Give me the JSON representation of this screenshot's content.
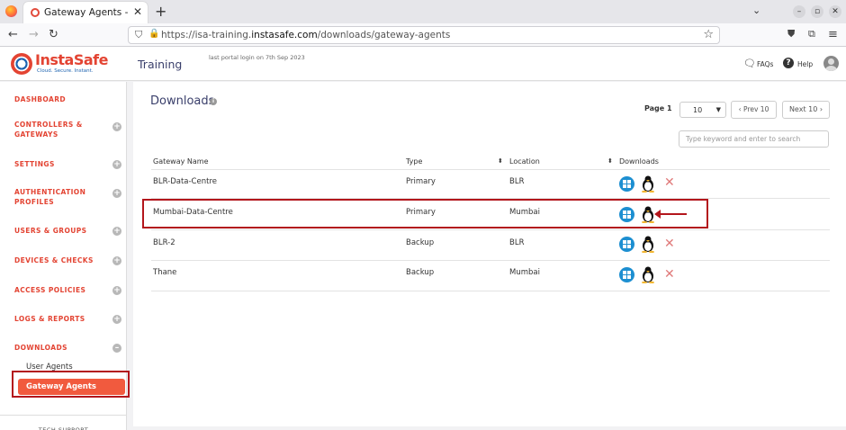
{
  "browser": {
    "tab_title": "Gateway Agents - Trainin",
    "url_prefix": "https://isa-training.",
    "url_domain": "instasafe.com",
    "url_path": "/downloads/gateway-agents"
  },
  "header": {
    "logo_text": "InstaSafe",
    "logo_tagline": "Cloud. Secure. Instant.",
    "title": "Training",
    "last_login": "last portal login on 7th Sep 2023",
    "faqs": "FAQs",
    "help": "Help"
  },
  "sidebar": {
    "items": [
      {
        "label": "DASHBOARD"
      },
      {
        "label": "CONTROLLERS &",
        "label2": "GATEWAYS"
      },
      {
        "label": "SETTINGS"
      },
      {
        "label": "AUTHENTICATION",
        "label2": "PROFILES"
      },
      {
        "label": "USERS & GROUPS"
      },
      {
        "label": "DEVICES & CHECKS"
      },
      {
        "label": "ACCESS POLICIES"
      },
      {
        "label": "LOGS & REPORTS"
      },
      {
        "label": "DOWNLOADS"
      }
    ],
    "sub_items": [
      "User Agents",
      "Gateway Agents"
    ],
    "footer": "TECH SUPPORT"
  },
  "main": {
    "title": "Downloads",
    "page_label": "Page 1",
    "page_size": "10",
    "prev_label": "Prev 10",
    "next_label": "Next 10",
    "search_placeholder": "Type keyword and enter to search",
    "columns": [
      "Gateway Name",
      "Type",
      "Location",
      "Downloads"
    ],
    "rows": [
      {
        "name": "BLR-Data-Centre",
        "type": "Primary",
        "location": "BLR"
      },
      {
        "name": "Mumbai-Data-Centre",
        "type": "Primary",
        "location": "Mumbai"
      },
      {
        "name": "BLR-2",
        "type": "Backup",
        "location": "BLR"
      },
      {
        "name": "Thane",
        "type": "Backup",
        "location": "Mumbai"
      }
    ]
  },
  "colors": {
    "accent": "#e34433",
    "active_item": "#f15a3e",
    "highlight": "#b3161c",
    "windows_icon": "#1d8fd1"
  }
}
